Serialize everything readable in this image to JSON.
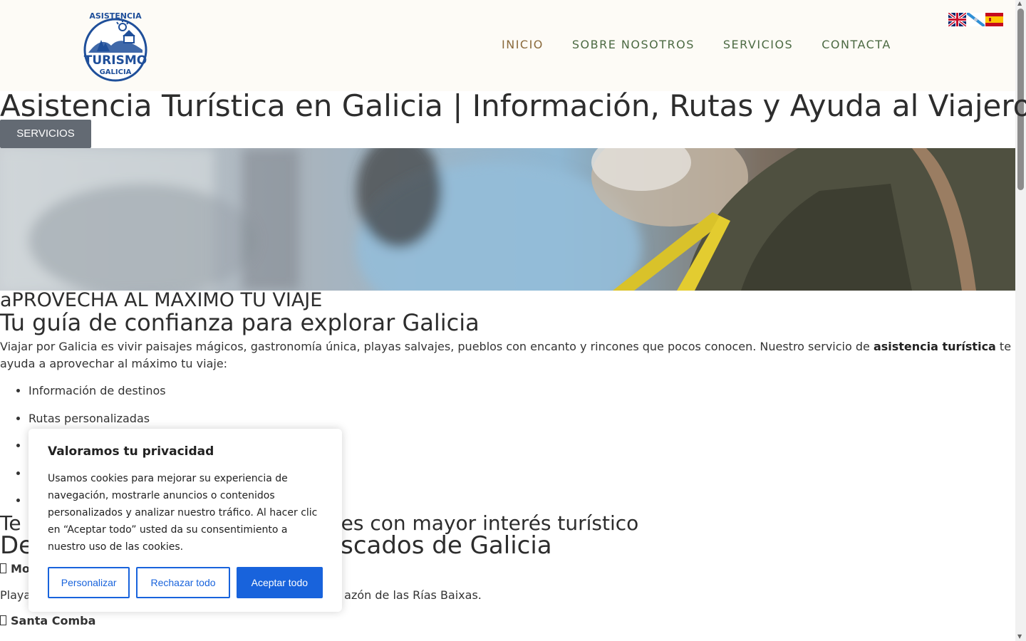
{
  "header": {
    "logo": {
      "top_text": "ASISTENCIA",
      "main_text": "TURISMO",
      "sub_text": "GALICIA"
    },
    "nav": [
      "INICIO",
      "SOBRE NOSOTROS",
      "SERVICIOS",
      "CONTACTA"
    ],
    "active_nav": "INICIO",
    "flags": [
      "flag-uk-icon",
      "flag-galicia-icon",
      "flag-spain-icon"
    ]
  },
  "page": {
    "title": "Asistencia Turística en Galicia | Información, Rutas y Ayuda al Viajero",
    "cta_button": "SERVICIOS"
  },
  "content": {
    "eyebrow": "aPROVECHA AL MAXIMO TU VIAJE",
    "heading": "Tu guía de confianza para explorar Galicia",
    "intro_before": "Viajar por Galicia es vivir paisajes mágicos, gastronomía única, playas salvajes, pueblos con encanto y rincones que pocos conocen. Nuestro servicio de ",
    "intro_bold": "asistencia turística",
    "intro_after": " te ayuda a aprovechar al máximo tu viaje:",
    "features": [
      "Información de destinos",
      "Rutas personalizadas",
      "",
      "",
      ""
    ],
    "section_eyebrow_start": "Te",
    "section_eyebrow_end": "ares con mayor interés turístico",
    "section_heading_start": "De",
    "section_heading_end": "scados de Galicia",
    "place1_partial": "Mo",
    "place1_desc_start": "Playa",
    "place1_desc_end": "azón de las Rías Baixas.",
    "place2": "Santa Comba"
  },
  "cookie_banner": {
    "title": "Valoramos tu privacidad",
    "text": "Usamos cookies para mejorar su experiencia de navegación, mostrarle anuncios o contenidos personalizados y analizar nuestro tráfico. Al hacer clic en “Aceptar todo” usted da su consentimiento a nuestro uso de las cookies.",
    "buttons": {
      "customize": "Personalizar",
      "reject": "Rechazar todo",
      "accept": "Aceptar todo"
    }
  },
  "colors": {
    "header_bg": "#fdfbf6",
    "nav": "#4c6a43",
    "nav_active": "#8a6a3c",
    "cta_bg": "#636a73",
    "cookie_accent": "#1863dc",
    "logo_blue": "#1f4f9a"
  }
}
